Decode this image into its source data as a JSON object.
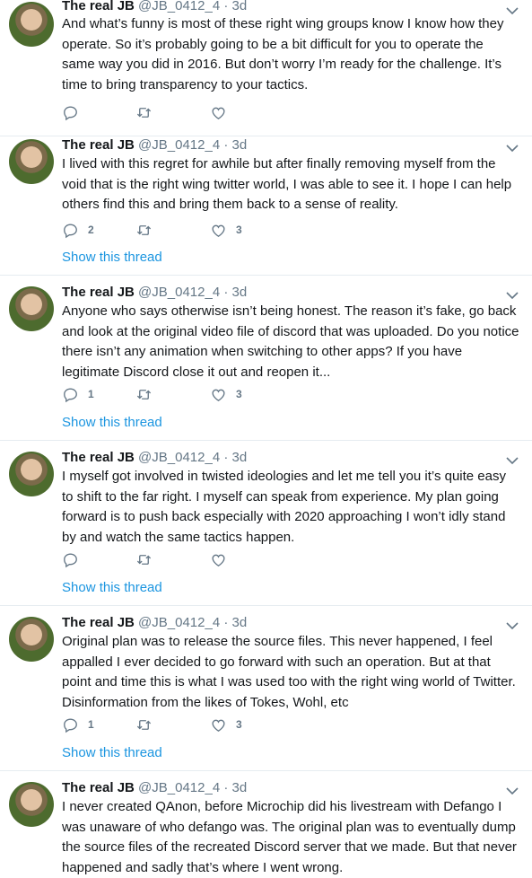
{
  "tweets": [
    {
      "name": "The real JB",
      "handle": "@JB_0412_4",
      "time": "3d",
      "text": "And what’s funny is most of these right wing groups know I know how they operate. So it’s probably going to be a bit difficult for you to operate the same way you did in 2016. But don’t worry I’m ready for the challenge. It’s time to bring transparency to your tactics.",
      "replies": "",
      "likes": "",
      "show_thread": ""
    },
    {
      "name": "The real JB",
      "handle": "@JB_0412_4",
      "time": "3d",
      "text": "I lived with this regret for awhile but after finally removing myself from the void that is the right wing twitter world, I was able to see it. I hope I can help others find this and bring them back to a sense of reality.",
      "replies": "2",
      "likes": "3",
      "show_thread": "Show this thread"
    },
    {
      "name": "The real JB",
      "handle": "@JB_0412_4",
      "time": "3d",
      "text": "Anyone who says otherwise isn’t being honest. The reason it’s fake, go back and look at the original video file of discord that was uploaded. Do you notice there isn’t any animation when switching to other apps? If you have legitimate Discord close it out and reopen it...",
      "replies": "1",
      "likes": "3",
      "show_thread": "Show this thread"
    },
    {
      "name": "The real JB",
      "handle": "@JB_0412_4",
      "time": "3d",
      "text": "I myself got involved in twisted ideologies and let me tell you it’s quite easy to shift to the far right. I myself can speak from experience. My plan going forward is to push back especially with 2020 approaching I won’t idly stand by and watch the same tactics happen.",
      "replies": "",
      "likes": "",
      "show_thread": "Show this thread"
    },
    {
      "name": "The real JB",
      "handle": "@JB_0412_4",
      "time": "3d",
      "text": "Original plan was to release the source files. This never happened, I feel appalled I ever decided to go forward with such an operation. But at that point and time this is what I was used too with the right wing world of Twitter. Disinformation from the likes of Tokes, Wohl, etc",
      "replies": "1",
      "likes": "3",
      "show_thread": "Show this thread"
    },
    {
      "name": "The real JB",
      "handle": "@JB_0412_4",
      "time": "3d",
      "text": "I never created QAnon, before Microchip did his livestream with Defango I was unaware of who defango was. The original plan was to eventually dump the source files of the recreated Discord server that we made. But that never happened and sadly that’s where I went wrong.",
      "replies": "",
      "likes": "",
      "show_thread": ""
    }
  ],
  "colors": {
    "text": "#14171a",
    "secondary": "#657786",
    "link": "#1b95e0",
    "divider": "#e6ecf0"
  },
  "icons": [
    "reply-icon",
    "retweet-icon",
    "like-icon",
    "chevron-down-icon"
  ]
}
